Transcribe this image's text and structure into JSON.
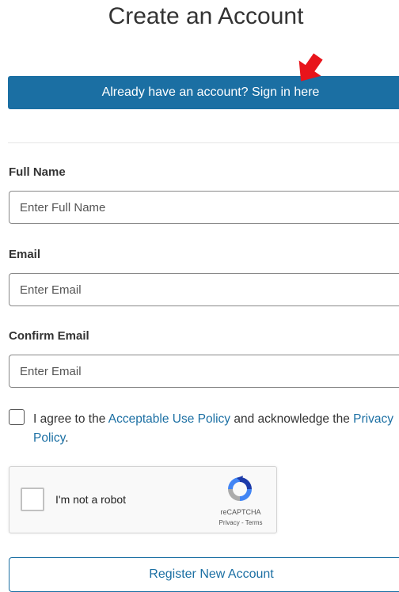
{
  "page_title": "Create an Account",
  "signin_button": "Already have an account? Sign in here",
  "form": {
    "full_name_label": "Full Name",
    "full_name_placeholder": "Enter Full Name",
    "email_label": "Email",
    "email_placeholder": "Enter Email",
    "confirm_email_label": "Confirm Email",
    "confirm_email_placeholder": "Enter Email"
  },
  "agreement": {
    "text_1": "I agree to the ",
    "link_aup": "Acceptable Use Policy",
    "text_2": " and acknowledge the ",
    "link_privacy": "Privacy Policy",
    "text_3": "."
  },
  "recaptcha": {
    "label": "I'm not a robot",
    "brand": "reCAPTCHA",
    "links": "Privacy - Terms"
  },
  "register_button": "Register New Account",
  "colors": {
    "primary": "#1b6fa3",
    "annotation_arrow": "#e8141b"
  }
}
